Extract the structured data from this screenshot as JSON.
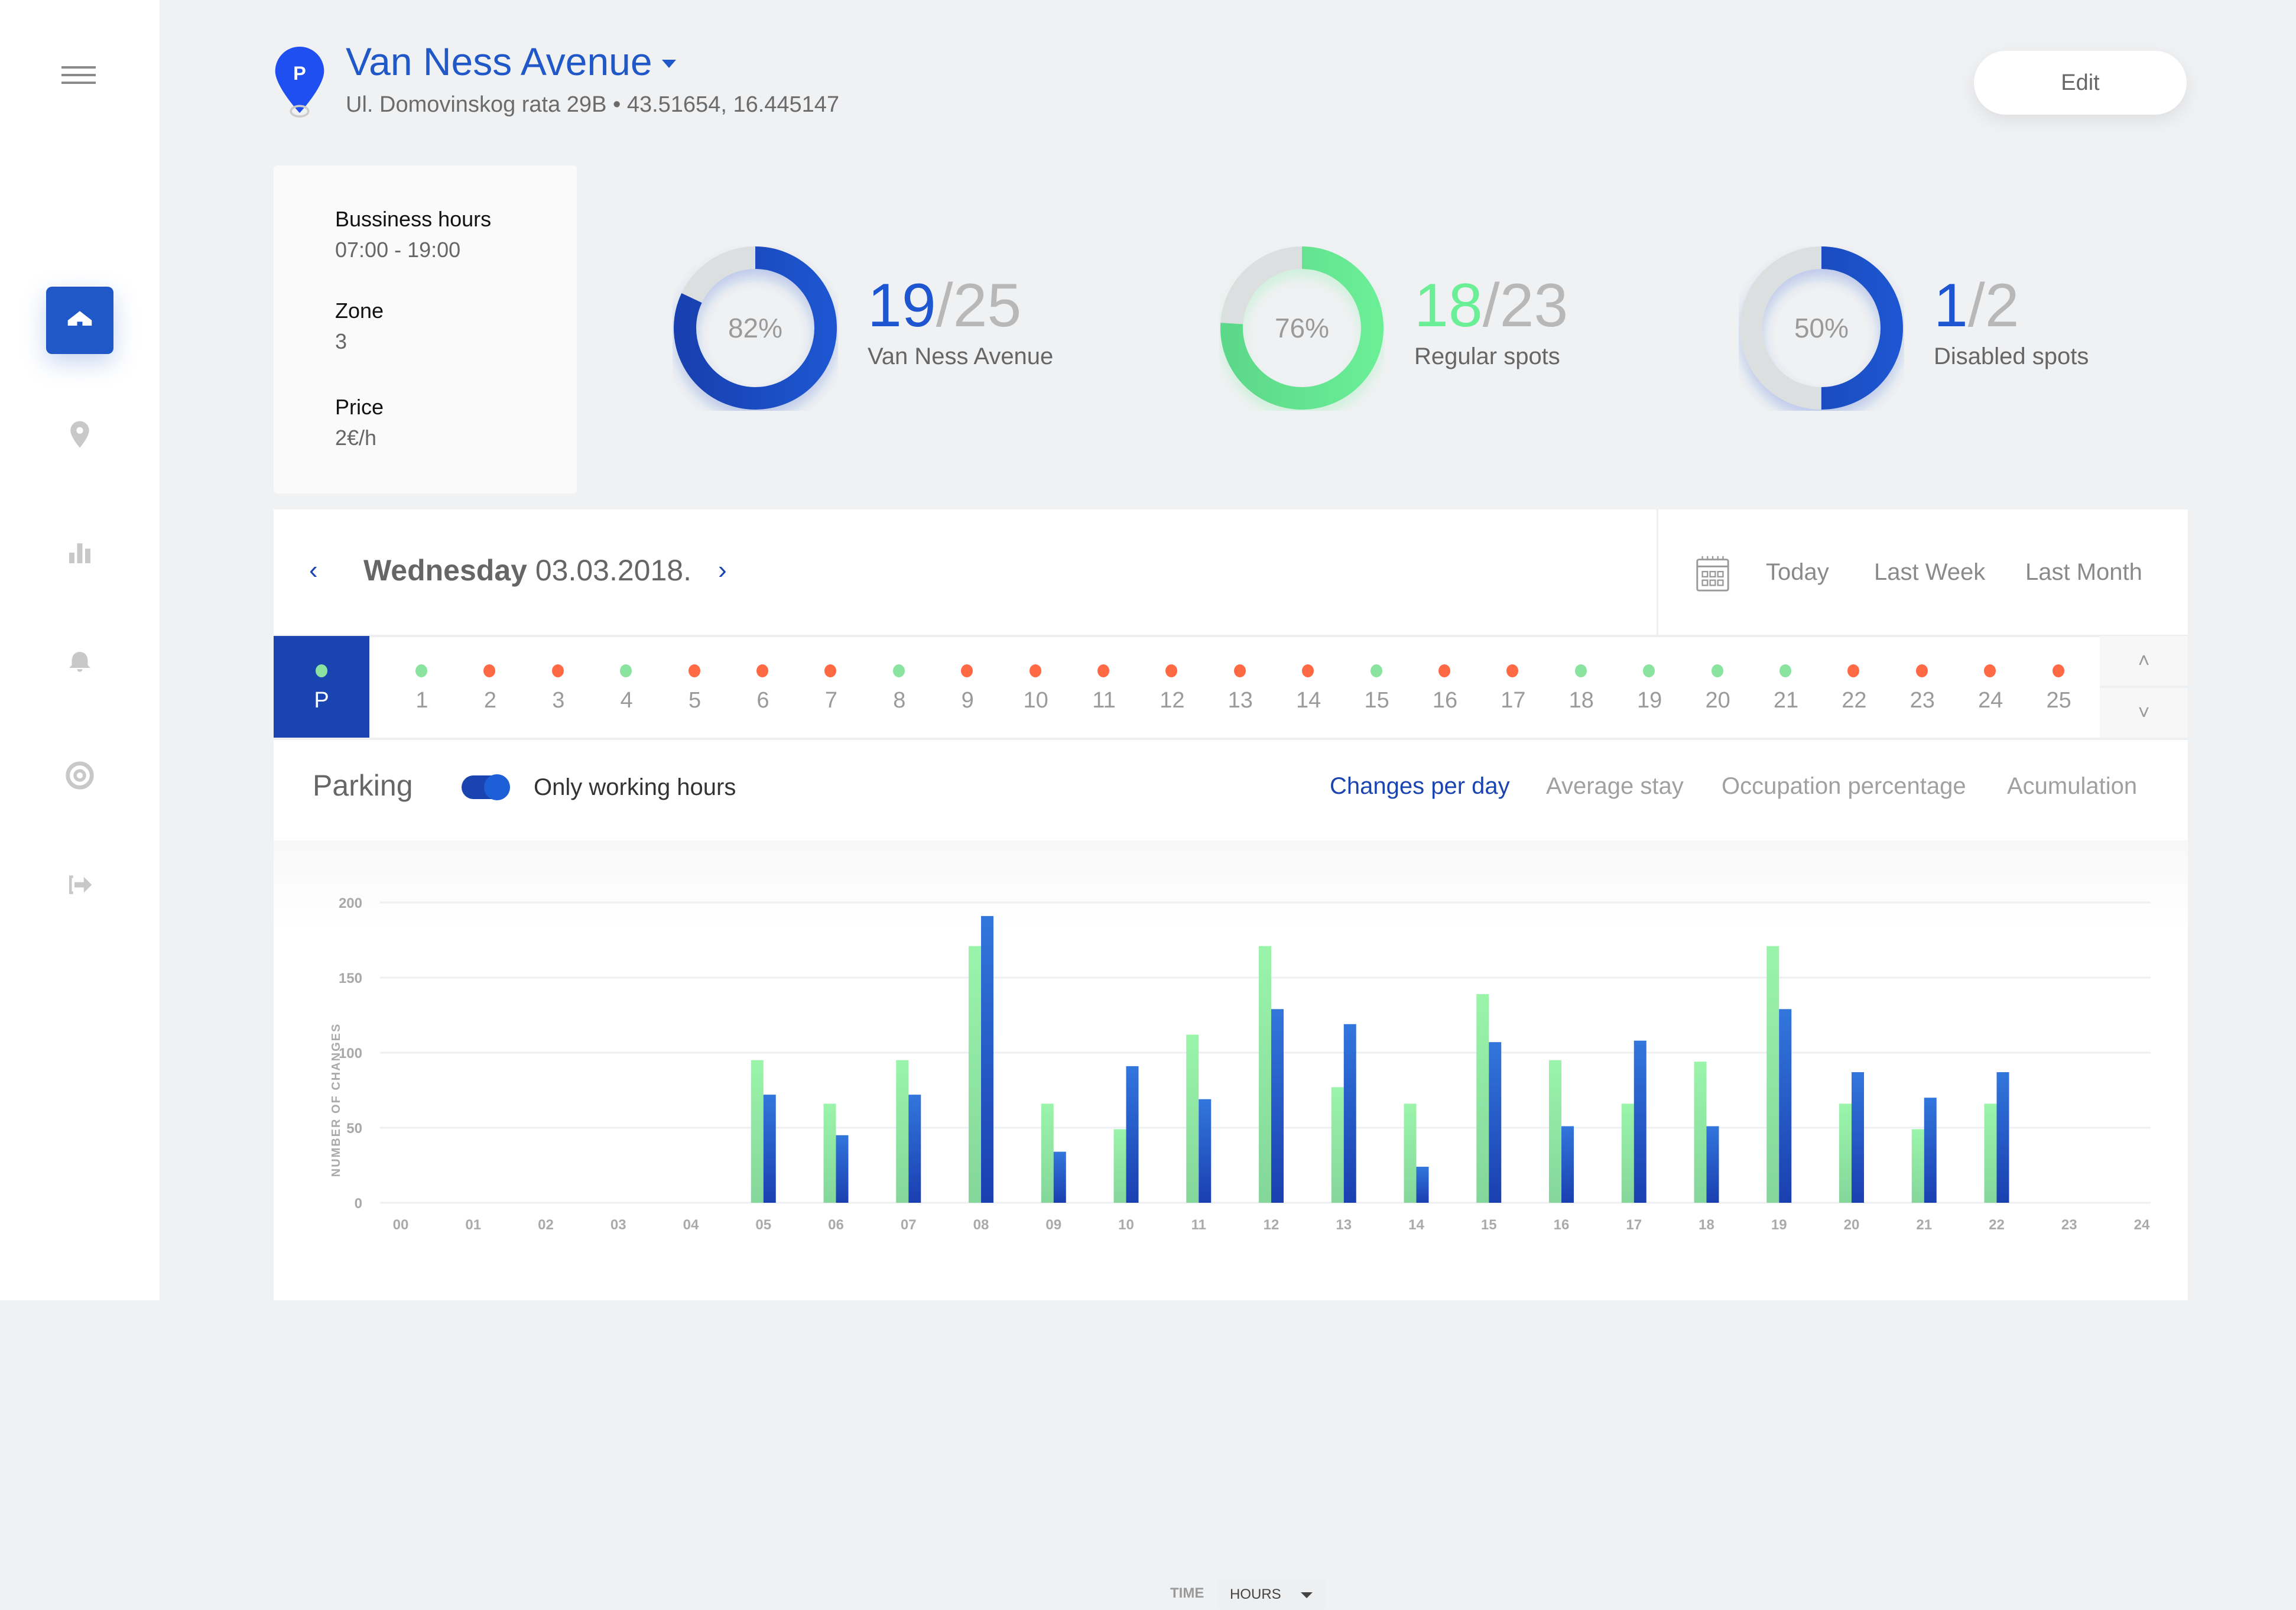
{
  "header": {
    "title": "Van Ness Avenue",
    "subtitle": "Ul. Domovinskog rata 29B • 43.51654, 16.445147",
    "pin_letter": "P",
    "edit_label": "Edit"
  },
  "sidebar": {
    "items": [
      {
        "name": "home",
        "active": true
      },
      {
        "name": "location"
      },
      {
        "name": "statistics"
      },
      {
        "name": "notifications"
      },
      {
        "name": "target"
      },
      {
        "name": "logout"
      }
    ]
  },
  "info": {
    "business_hours_label": "Bussiness hours",
    "business_hours_value": "07:00 - 19:00",
    "zone_label": "Zone",
    "zone_value": "3",
    "price_label": "Price",
    "price_value": "2€/h"
  },
  "stats": [
    {
      "percent_label": "82%",
      "percent": 82,
      "occupied": "19",
      "total": "/25",
      "label": "Van Ness Avenue",
      "color": "#1d56d0",
      "color_dark": "#1840b0"
    },
    {
      "percent_label": "76%",
      "percent": 76,
      "occupied": "18",
      "total": "/23",
      "label": "Regular spots",
      "color": "#6aee96",
      "color_dark": "#5cd88a"
    },
    {
      "percent_label": "50%",
      "percent": 50,
      "occupied": "1",
      "total": "/2",
      "label": "Disabled spots",
      "color": "#1d56d0",
      "color_dark": "#1840b0"
    }
  ],
  "date_nav": {
    "prev": "‹",
    "next": "›",
    "weekday": "Wednesday",
    "date": "03.03.2018.",
    "ranges": [
      "Today",
      "Last Week",
      "Last Month"
    ]
  },
  "spots": {
    "header": {
      "label": "P",
      "status": "free"
    },
    "items": [
      {
        "n": "1",
        "status": "free"
      },
      {
        "n": "2",
        "status": "occupied"
      },
      {
        "n": "3",
        "status": "occupied"
      },
      {
        "n": "4",
        "status": "free"
      },
      {
        "n": "5",
        "status": "occupied"
      },
      {
        "n": "6",
        "status": "occupied"
      },
      {
        "n": "7",
        "status": "occupied"
      },
      {
        "n": "8",
        "status": "free"
      },
      {
        "n": "9",
        "status": "occupied"
      },
      {
        "n": "10",
        "status": "occupied"
      },
      {
        "n": "11",
        "status": "occupied"
      },
      {
        "n": "12",
        "status": "occupied"
      },
      {
        "n": "13",
        "status": "occupied"
      },
      {
        "n": "14",
        "status": "occupied"
      },
      {
        "n": "15",
        "status": "free"
      },
      {
        "n": "16",
        "status": "occupied"
      },
      {
        "n": "17",
        "status": "occupied"
      },
      {
        "n": "18",
        "status": "free"
      },
      {
        "n": "19",
        "status": "free"
      },
      {
        "n": "20",
        "status": "free"
      },
      {
        "n": "21",
        "status": "free"
      },
      {
        "n": "22",
        "status": "occupied"
      },
      {
        "n": "23",
        "status": "occupied"
      },
      {
        "n": "24",
        "status": "occupied"
      },
      {
        "n": "25",
        "status": "occupied"
      }
    ],
    "colors": {
      "free": "#8be3a0",
      "occupied": "#ff6a45"
    },
    "scroll_up": "˄",
    "scroll_down": "˅"
  },
  "tabs": {
    "section_label": "Parking",
    "toggle_label": "Only working hours",
    "toggle_on": true,
    "items": [
      {
        "label": "Changes per day",
        "active": true
      },
      {
        "label": "Average stay"
      },
      {
        "label": "Occupation percentage"
      },
      {
        "label": "Acumulation"
      }
    ]
  },
  "time_selector": {
    "label": "TIME",
    "value": "HOURS"
  },
  "chart_data": {
    "type": "bar",
    "title": "",
    "xlabel": "TIME",
    "ylabel": "NUMBER OF CHANGES",
    "ylim": [
      0,
      200
    ],
    "yticks": [
      0,
      50,
      100,
      150,
      200
    ],
    "grid": true,
    "categories": [
      "00",
      "01",
      "02",
      "03",
      "04",
      "05",
      "06",
      "07",
      "08",
      "09",
      "10",
      "11",
      "12",
      "13",
      "14",
      "15",
      "16",
      "17",
      "18",
      "19",
      "20",
      "21",
      "22",
      "23",
      "24"
    ],
    "series": [
      {
        "name": "series-green",
        "color": "#96f0a8",
        "values": [
          0,
          0,
          0,
          0,
          0,
          95,
          66,
          95,
          171,
          66,
          49,
          112,
          171,
          77,
          66,
          139,
          95,
          66,
          94,
          171,
          66,
          49,
          66,
          0,
          0
        ]
      },
      {
        "name": "series-blue",
        "color": "#2a62d4",
        "values": [
          0,
          0,
          0,
          0,
          0,
          72,
          45,
          72,
          191,
          34,
          91,
          69,
          129,
          119,
          24,
          107,
          51,
          108,
          51,
          129,
          87,
          70,
          87,
          0,
          0
        ]
      }
    ]
  }
}
